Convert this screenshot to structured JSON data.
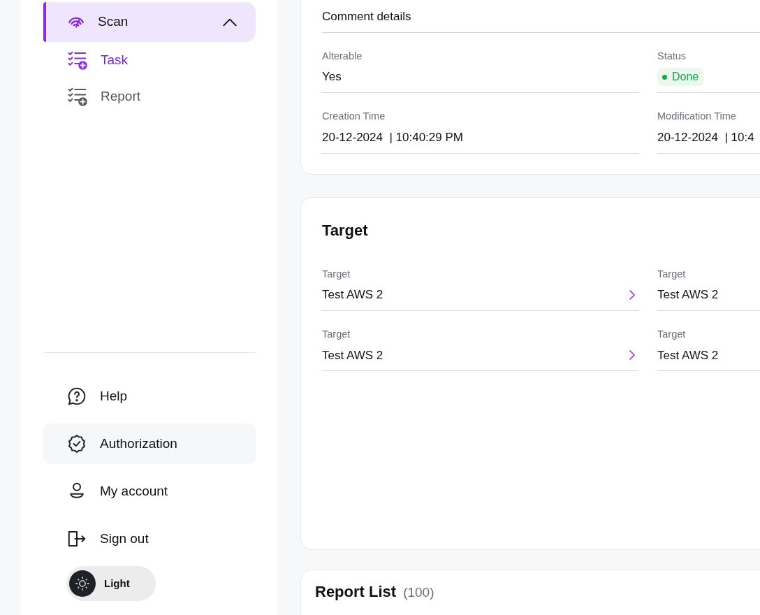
{
  "sidebar": {
    "nav": [
      {
        "label": "Scan",
        "expanded": true,
        "active": true,
        "children": [
          {
            "label": "Task",
            "selected": true
          },
          {
            "label": "Report",
            "selected": false
          }
        ]
      }
    ],
    "bottom": [
      {
        "label": "Help",
        "hovered": false
      },
      {
        "label": "Authorization",
        "hovered": true
      },
      {
        "label": "My account",
        "hovered": false
      },
      {
        "label": "Sign out",
        "hovered": false
      }
    ],
    "theme_toggle": {
      "label": "Light",
      "on": false
    }
  },
  "details": {
    "comment": "Comment details",
    "fields": [
      {
        "label": "Alterable",
        "value": "Yes",
        "kind": "text"
      },
      {
        "label": "Status",
        "value": "Done",
        "kind": "status",
        "color": "#1aa34a"
      },
      {
        "label": "Creation Time",
        "value": "20-12-2024  | 10:40:29 PM",
        "kind": "text"
      },
      {
        "label": "Modification Time",
        "value": "20-12-2024  | 10:4",
        "kind": "text"
      }
    ]
  },
  "target": {
    "title": "Target",
    "fields": [
      {
        "label": "Target",
        "value": "Test AWS 2",
        "link": true
      },
      {
        "label": "Target",
        "value": "Test AWS 2",
        "link": false
      },
      {
        "label": "Target",
        "value": "Test AWS 2",
        "link": true
      },
      {
        "label": "Target",
        "value": "Test AWS 2",
        "link": false
      }
    ]
  },
  "report_list": {
    "title": "Report List",
    "count": "(100)"
  }
}
